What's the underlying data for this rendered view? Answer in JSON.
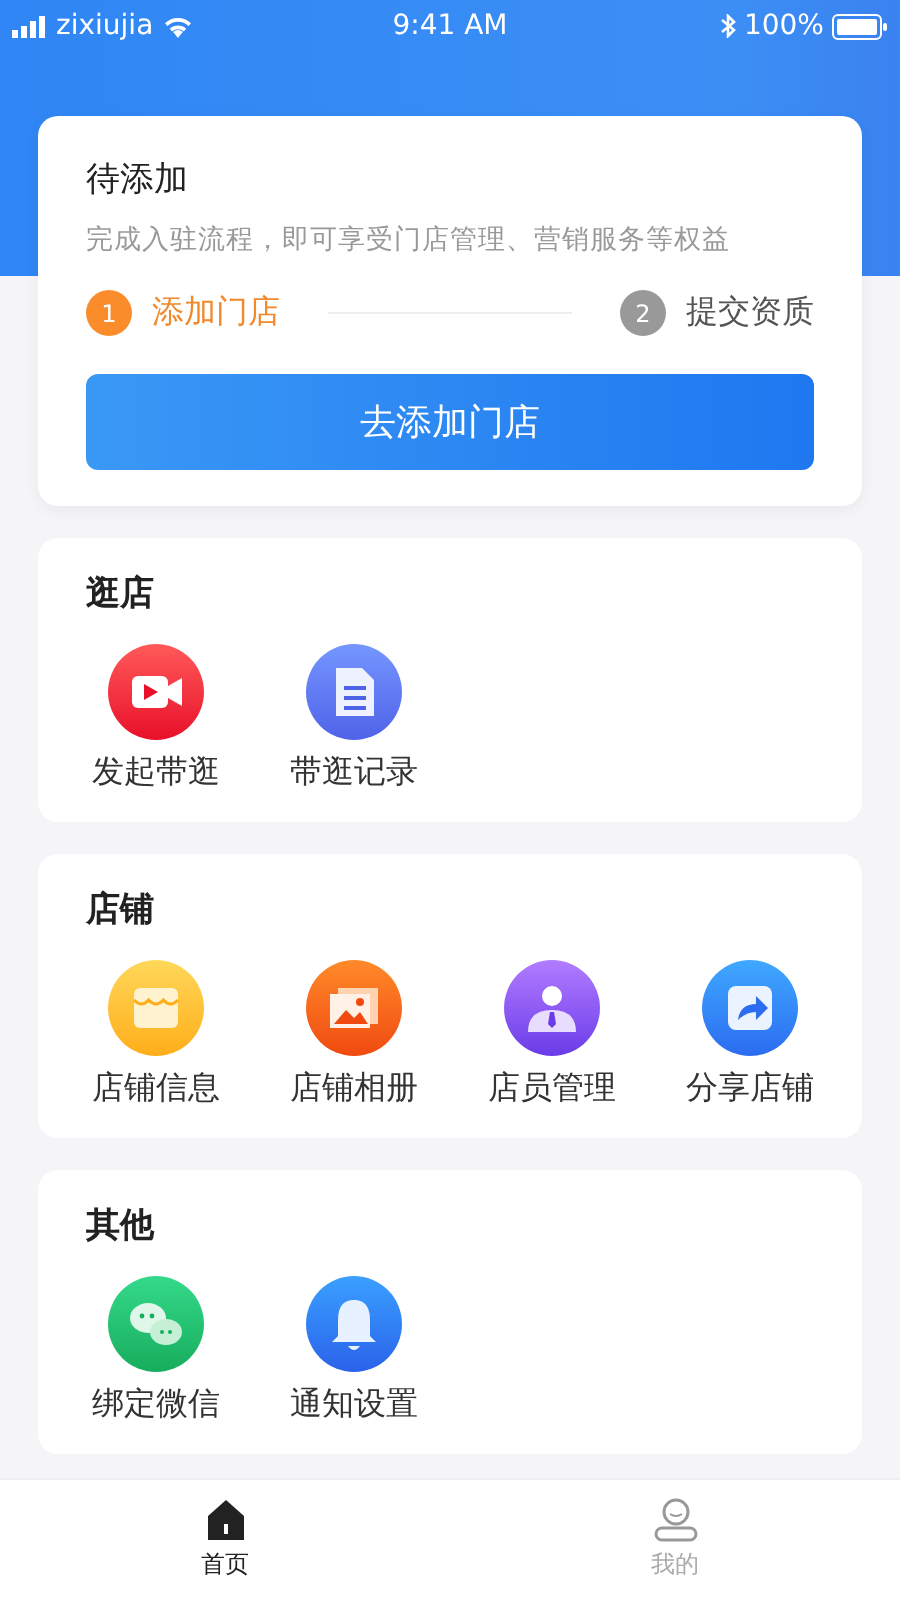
{
  "status_bar": {
    "carrier": "zixiujia",
    "time": "9:41 AM",
    "battery": "100%"
  },
  "pending_card": {
    "title": "待添加",
    "description": "完成入驻流程，即可享受门店管理、营销服务等权益",
    "steps": [
      {
        "number": "1",
        "label": "添加门店",
        "active": true
      },
      {
        "number": "2",
        "label": "提交资质",
        "active": false
      }
    ],
    "button": "去添加门店"
  },
  "sections": [
    {
      "title": "逛店",
      "items": [
        {
          "label": "发起带逛",
          "kind": "video"
        },
        {
          "label": "带逛记录",
          "kind": "doc"
        }
      ]
    },
    {
      "title": "店铺",
      "items": [
        {
          "label": "店铺信息",
          "kind": "store"
        },
        {
          "label": "店铺相册",
          "kind": "album"
        },
        {
          "label": "店员管理",
          "kind": "staff"
        },
        {
          "label": "分享店铺",
          "kind": "share"
        }
      ]
    },
    {
      "title": "其他",
      "items": [
        {
          "label": "绑定微信",
          "kind": "wechat"
        },
        {
          "label": "通知设置",
          "kind": "bell"
        }
      ]
    }
  ],
  "tab_bar": [
    {
      "label": "首页",
      "kind": "home",
      "selected": true
    },
    {
      "label": "我的",
      "kind": "profile",
      "selected": false
    }
  ]
}
